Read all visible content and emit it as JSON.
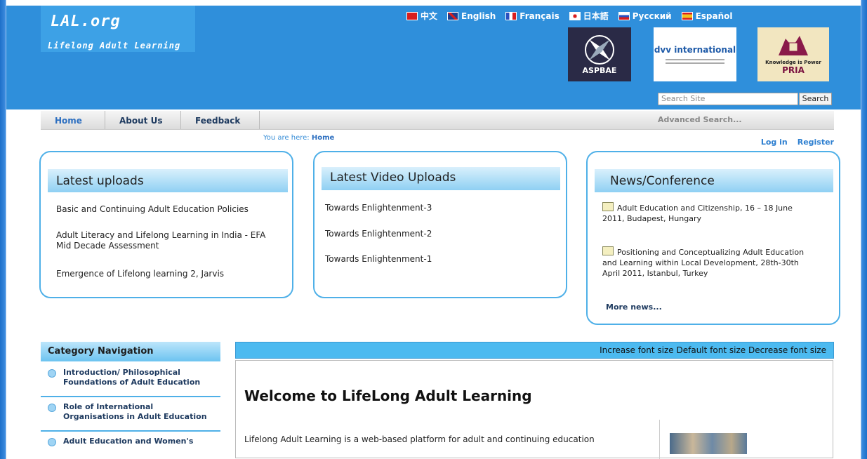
{
  "logo": {
    "mark": "LAL.org",
    "tagline": "Lifelong Adult Learning"
  },
  "languages": [
    {
      "label": "中文",
      "flag_color": "#d81e1e"
    },
    {
      "label": "English",
      "flag_color": "#1f3f8f"
    },
    {
      "label": "Français",
      "flag_color": "#2a4fbf"
    },
    {
      "label": "日本語",
      "flag_color": "#d81e1e"
    },
    {
      "label": "Русский",
      "flag_color": "#2a4fbf"
    },
    {
      "label": "Español",
      "flag_color": "#d8a51e"
    }
  ],
  "partners": {
    "aspbae": "ASPBAE",
    "dvv": "dvv international",
    "pria_tagline": "Knowledge is Power",
    "pria": "PRIA"
  },
  "search": {
    "placeholder": "Search Site",
    "button": "Search",
    "advanced": "Advanced Search..."
  },
  "nav": [
    "Home",
    "About Us",
    "Feedback"
  ],
  "breadcrumb": {
    "prefix": "You are here:",
    "current": "Home"
  },
  "auth": {
    "login": "Log in",
    "register": "Register"
  },
  "latest_uploads": {
    "title": "Latest uploads",
    "items": [
      "Basic and Continuing Adult Education Policies",
      "Adult Literacy and Lifelong Learning in India - EFA",
      "Mid Decade Assessment",
      "Emergence of Lifelong learning 2, Jarvis"
    ]
  },
  "latest_video": {
    "title": "Latest Video Uploads",
    "items": [
      "Towards Enlightenment-3",
      "Towards Enlightenment-2",
      "Towards Enlightenment-1"
    ]
  },
  "news": {
    "title": "News/Conference",
    "items": [
      [
        "Adult Education and Citizenship, 16 – 18 June",
        "2011, Budapest, Hungary"
      ],
      [
        "Positioning and Conceptualizing Adult Education",
        "and Learning within Local Development, 28th-30th",
        "April 2011, Istanbul, Turkey"
      ]
    ],
    "more": "More news..."
  },
  "category_nav": {
    "title": "Category Navigation",
    "items": [
      [
        "Introduction/ Philosophical",
        "Foundations of Adult Education"
      ],
      [
        "Role of International",
        "Organisations in Adult Education"
      ],
      [
        "Adult Education and Women's"
      ]
    ]
  },
  "font_controls": {
    "increase": "Increase font size",
    "default": "Default font size",
    "decrease": "Decrease font size"
  },
  "main": {
    "heading": "Welcome to LifeLong Adult Learning",
    "intro": "Lifelong Adult Learning is a web-based platform for adult and continuing education"
  },
  "colors": {
    "header_blue": "#2f8fdb",
    "box_border": "#4fb0e8",
    "accent": "#4cbaf0"
  }
}
